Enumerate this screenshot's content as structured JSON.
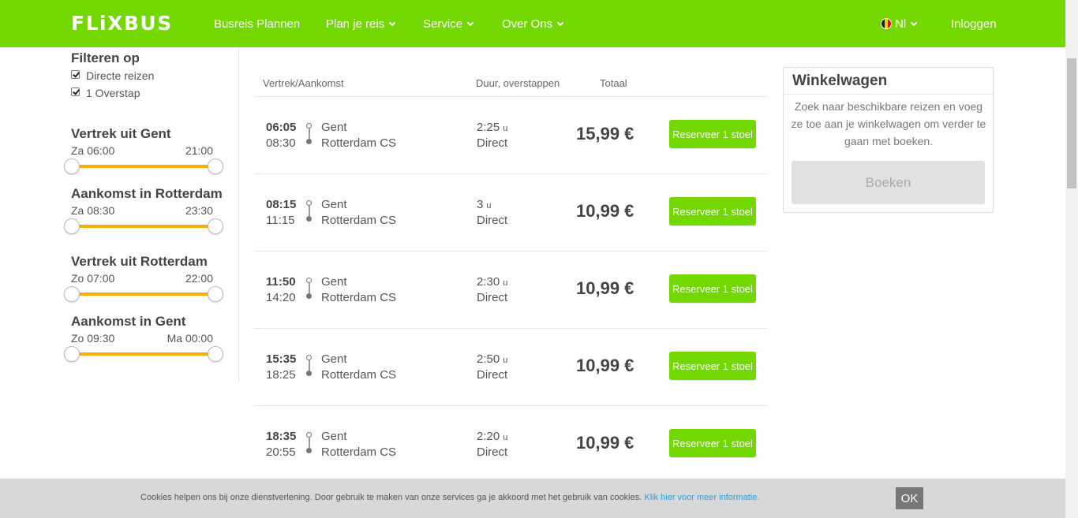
{
  "header": {
    "logo": "FLiXBUS",
    "nav": [
      "Busreis Plannen",
      "Plan je reis",
      "Service",
      "Over Ons"
    ],
    "language": "Nl",
    "login": "Inloggen"
  },
  "filters": {
    "title": "Filteren op",
    "checkboxes": [
      {
        "label": "Directe reizen",
        "checked": true
      },
      {
        "label": "1 Overstap",
        "checked": true
      }
    ],
    "ranges": [
      {
        "title": "Vertrek uit Gent",
        "min": "Za 06:00",
        "max": "21:00"
      },
      {
        "title": "Aankomst in Rotterdam",
        "min": "Za 08:30",
        "max": "23:30"
      },
      {
        "title": "Vertrek uit Rotterdam",
        "min": "Zo 07:00",
        "max": "22:00"
      },
      {
        "title": "Aankomst in Gent",
        "min": "Zo 09:30",
        "max": "Ma 00:00"
      }
    ]
  },
  "results": {
    "headers": {
      "route": "Vertrek/Aankomst",
      "duration": "Duur, overstappen",
      "total": "Totaal"
    },
    "rows": [
      {
        "dep": "06:05",
        "arr": "08:30",
        "from": "Gent",
        "to": "Rotterdam CS",
        "dur": "2:25",
        "unit": "u",
        "transfer": "Direct",
        "price": "15,99 €",
        "button": "Reserveer 1 stoel"
      },
      {
        "dep": "08:15",
        "arr": "11:15",
        "from": "Gent",
        "to": "Rotterdam CS",
        "dur": "3",
        "unit": "u",
        "transfer": "Direct",
        "price": "10,99 €",
        "button": "Reserveer 1 stoel"
      },
      {
        "dep": "11:50",
        "arr": "14:20",
        "from": "Gent",
        "to": "Rotterdam CS",
        "dur": "2:30",
        "unit": "u",
        "transfer": "Direct",
        "price": "10,99 €",
        "button": "Reserveer 1 stoel"
      },
      {
        "dep": "15:35",
        "arr": "18:25",
        "from": "Gent",
        "to": "Rotterdam CS",
        "dur": "2:50",
        "unit": "u",
        "transfer": "Direct",
        "price": "10,99 €",
        "button": "Reserveer 1 stoel"
      },
      {
        "dep": "18:35",
        "arr": "20:55",
        "from": "Gent",
        "to": "Rotterdam CS",
        "dur": "2:20",
        "unit": "u",
        "transfer": "Direct",
        "price": "10,99 €",
        "button": "Reserveer 1 stoel"
      }
    ]
  },
  "cart": {
    "title": "Winkelwagen",
    "text": "Zoek naar beschikbare reizen en voeg ze toe aan je winkelwagen om verder te gaan met boeken.",
    "button": "Boeken"
  },
  "cookie": {
    "text": "Cookies helpen ons bij onze dienstverlening. Door gebruik te maken van onze services ga je akkoord met het gebruik van cookies.",
    "link": "Klik hier voor meer informatie.",
    "ok": "OK"
  },
  "colors": {
    "brand": "#73d700",
    "slider": "#ffad00",
    "link": "#2d9fd9"
  }
}
